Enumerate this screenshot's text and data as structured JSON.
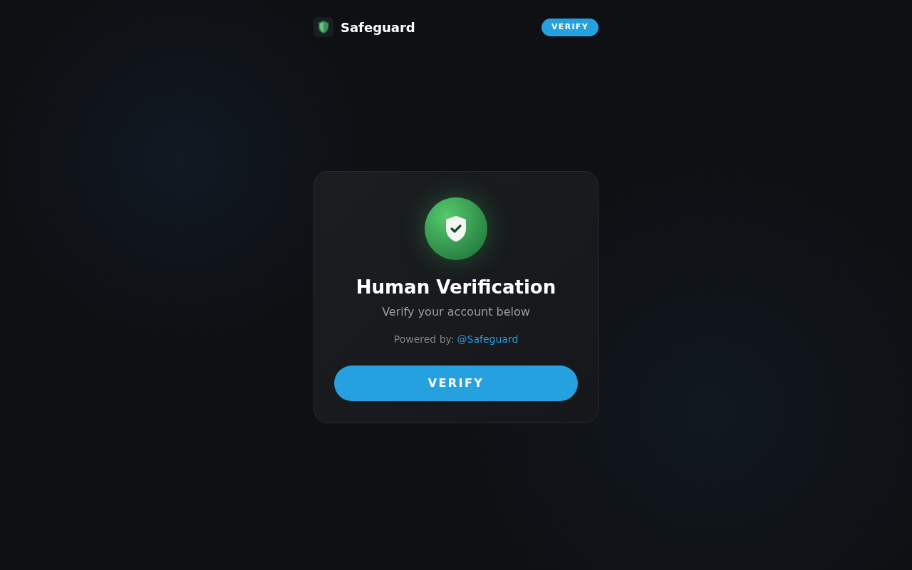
{
  "header": {
    "brand": "Safeguard",
    "verify_button": "VERIFY"
  },
  "card": {
    "title": "Human Verification",
    "subtitle": "Verify your account below",
    "powered_by": {
      "label": "Powered by:",
      "link": "@Safeguard"
    },
    "button": "VERIFY"
  }
}
